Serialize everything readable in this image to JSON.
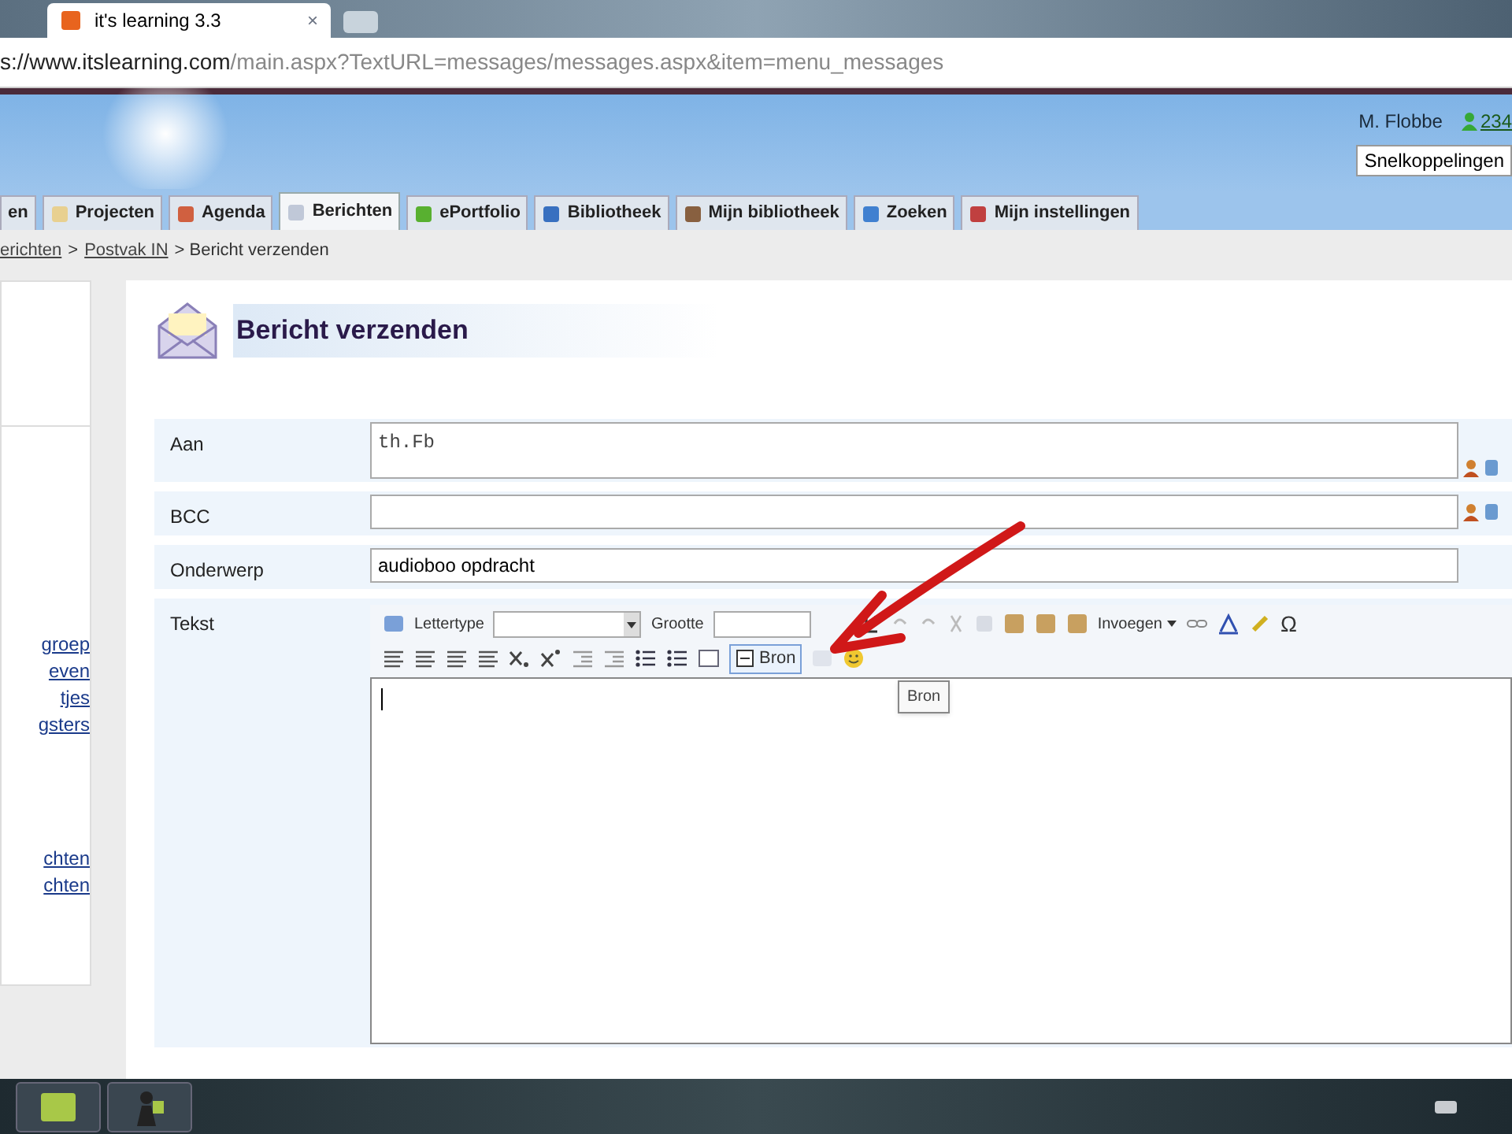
{
  "browser": {
    "tab": {
      "title": "it's learning 3.3",
      "close": "×"
    },
    "address": {
      "host": "s://www.itslearning.com",
      "path": "/main.aspx?TextURL=messages/messages.aspx&item=menu_messages"
    }
  },
  "header": {
    "user": "M. Flobbe",
    "count": "234",
    "shortcuts": "Snelkoppelingen"
  },
  "nav_tabs": [
    {
      "label": "en",
      "selected": false
    },
    {
      "label": "Projecten",
      "selected": false
    },
    {
      "label": "Agenda",
      "selected": false
    },
    {
      "label": "Berichten",
      "selected": true
    },
    {
      "label": "ePortfolio",
      "selected": false
    },
    {
      "label": "Bibliotheek",
      "selected": false
    },
    {
      "label": "Mijn bibliotheek",
      "selected": false
    },
    {
      "label": "Zoeken",
      "selected": false
    },
    {
      "label": "Mijn instellingen",
      "selected": false
    }
  ],
  "breadcrumb": [
    {
      "text": "erichten",
      "kind": "link"
    },
    {
      "text": ">",
      "kind": "text"
    },
    {
      "text": "Postvak IN",
      "kind": "link"
    },
    {
      "text": "> Bericht verzenden",
      "kind": "text"
    }
  ],
  "sidebar": {
    "link_groups": [
      [
        "groep",
        "even",
        "tjes",
        "gsters"
      ],
      [
        "chten",
        "chten"
      ]
    ]
  },
  "page_title": "Bericht verzenden",
  "form": [
    {
      "label": "Aan",
      "kind": "textarea",
      "value": "th.Fb",
      "picker": true
    },
    {
      "label": "BCC",
      "kind": "input",
      "picker": true
    },
    {
      "label": "Onderwerp",
      "kind": "input",
      "value": "audioboo opdracht",
      "picker": false
    },
    {
      "label": "Tekst",
      "kind": "editor"
    }
  ],
  "editor": {
    "font_label": "Lettertype",
    "size_label": "Grootte",
    "insert_menu": "Invoegen",
    "special_char": "Ω",
    "source_button": {
      "label": "Bron",
      "hovered": true
    },
    "tooltip": "Bron"
  }
}
